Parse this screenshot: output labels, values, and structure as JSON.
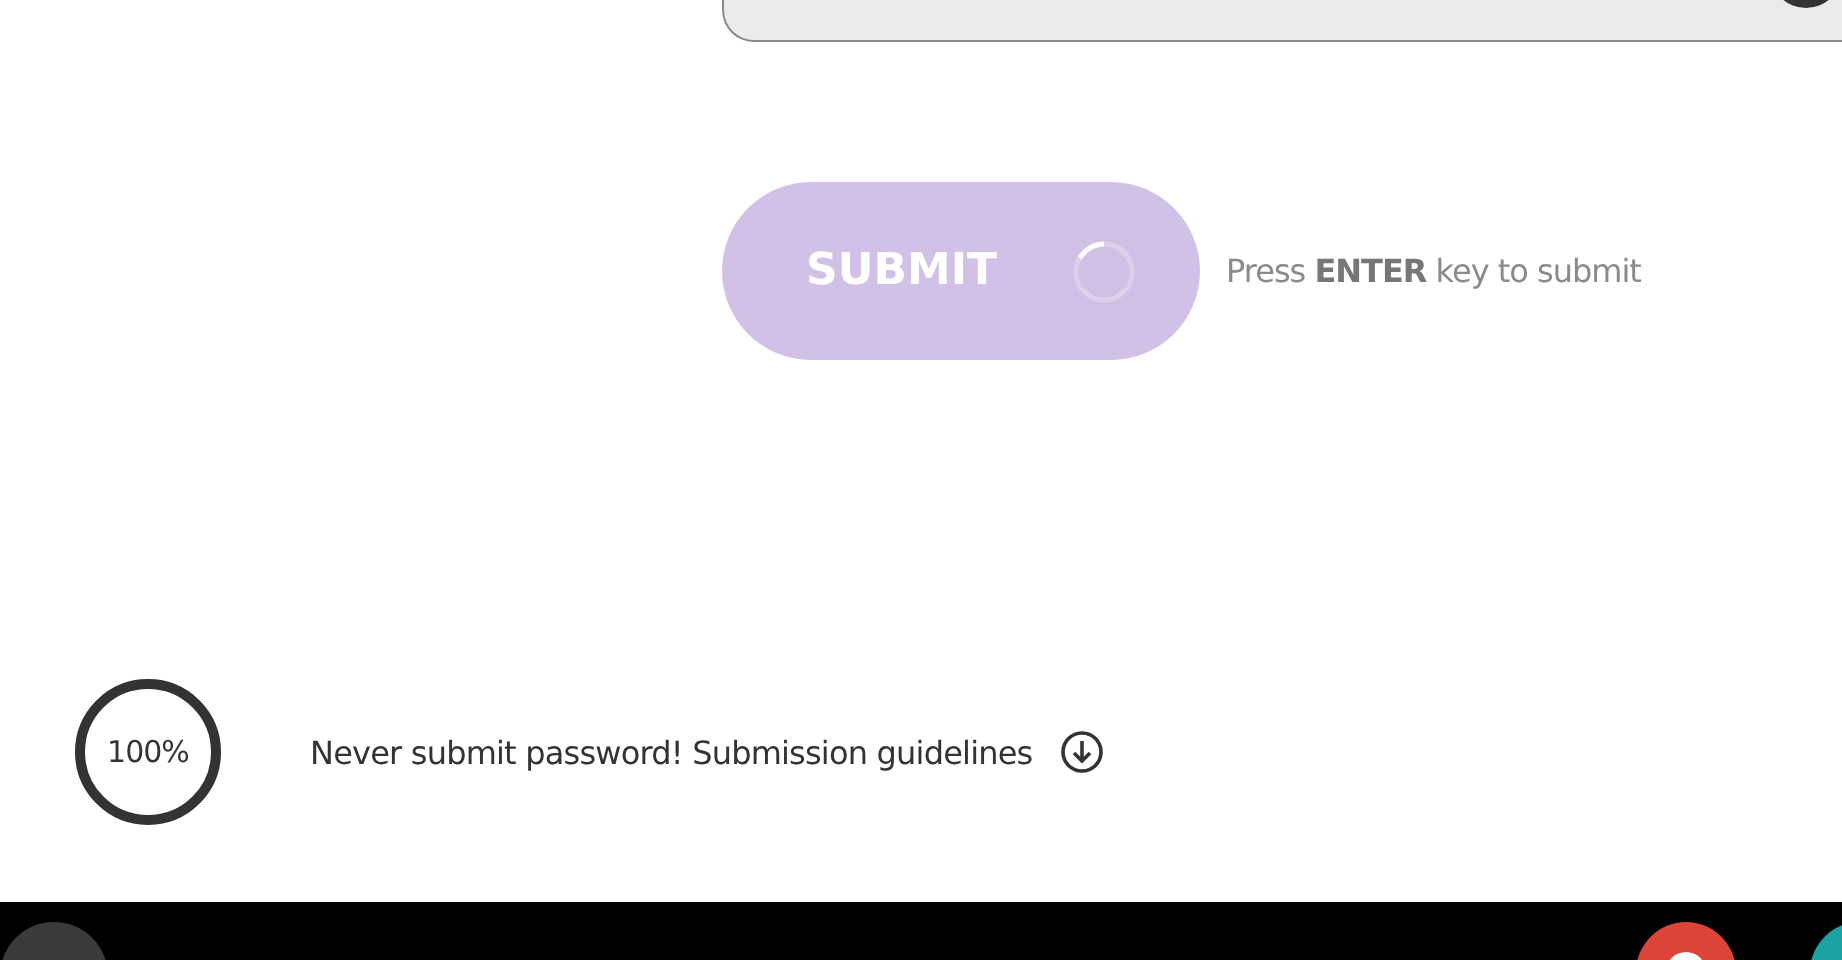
{
  "answer_field": {
    "disabled": true
  },
  "submit": {
    "label": "SUBMIT",
    "disabled": true,
    "loading": true
  },
  "hint": "Press **ENTER** key to submit",
  "progress": {
    "label": "100%",
    "level": 1
  },
  "notice": {
    "text": "Never submit password! Submission guidelines"
  }
}
